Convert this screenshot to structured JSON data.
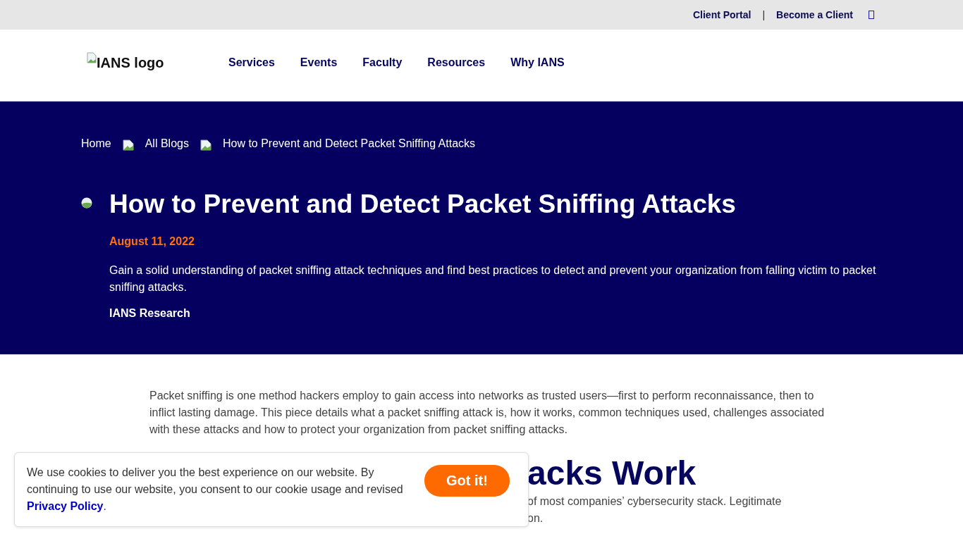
{
  "top_bar": {
    "links": [
      "Client Portal",
      "Become a Client"
    ],
    "separator": "|"
  },
  "header": {
    "logo_alt": "IANS logo",
    "nav": [
      "Services",
      "Events",
      "Faculty",
      "Resources",
      "Why IANS"
    ]
  },
  "hero": {
    "breadcrumbs": [
      "Home",
      "All Blogs",
      "How to Prevent and Detect Packet Sniffing Attacks"
    ],
    "title": "How to Prevent and Detect Packet Sniffing Attacks",
    "date": "August 11, 2022",
    "summary": "Gain a solid understanding of packet sniffing attack techniques and find best practices to detect and prevent your organization from falling victim to packet sniffing attacks.",
    "author": "IANS Research"
  },
  "article": {
    "intro": "Packet sniffing is one method hackers employ to gain access into networks as trusted users—first to perform reconnaissance, then to inflict lasting damage. This piece details what a packet sniffing attack is, how it works, common techniques used, challenges associated with these attacks and how to protect your organization from packet sniffing attacks.",
    "heading": "acks Work",
    "lines": [
      "of most companies’ cybersecurity stack. Legitimate",
      "on."
    ]
  },
  "cookie_banner": {
    "text": "We use cookies to deliver you the best experience on our website. By continuing to use our website, you consent to our cookie usage and revised ",
    "link": "Privacy Policy",
    "after_link": ".",
    "button": "Got it!"
  }
}
